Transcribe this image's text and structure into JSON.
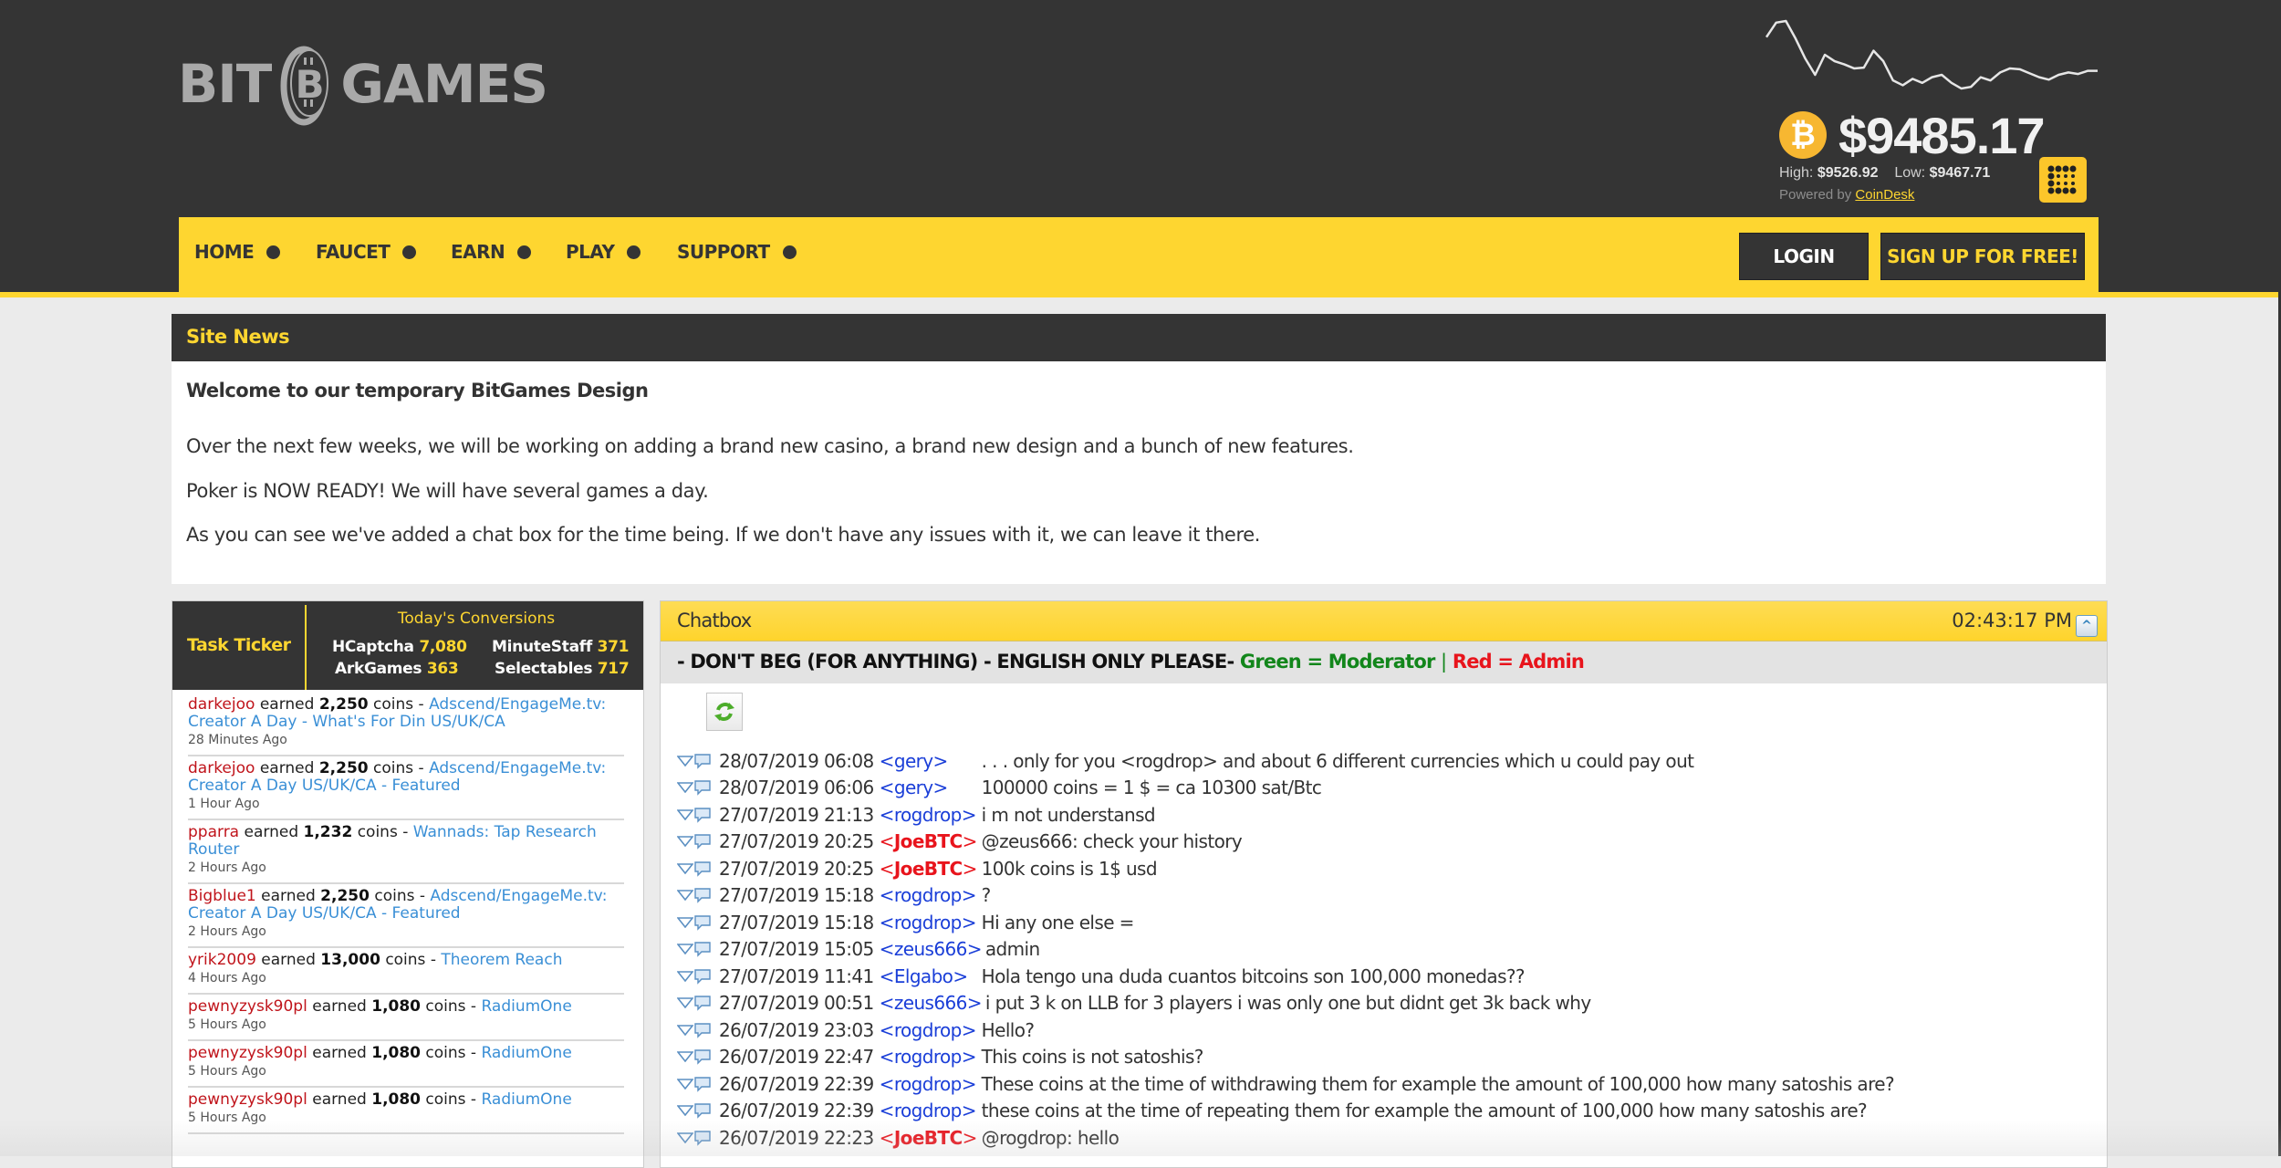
{
  "brand": {
    "logo_left": "BIT",
    "logo_right": "GAMES",
    "logo_coin_icon": "bitcoin-coin-icon"
  },
  "ticker_widget": {
    "price": "$9485.17",
    "high_label": "High:",
    "high_value": "$9526.92",
    "low_label": "Low:",
    "low_value": "$9467.71",
    "powered_by": "Powered by",
    "powered_link": "CoinDesk",
    "coin_glyph": "₿",
    "sparkline_trend": [
      0.72,
      0.9,
      0.92,
      0.7,
      0.45,
      0.25,
      0.5,
      0.42,
      0.38,
      0.33,
      0.34,
      0.55,
      0.42,
      0.18,
      0.12,
      0.2,
      0.15,
      0.22,
      0.25,
      0.15,
      0.08,
      0.1,
      0.22,
      0.18,
      0.28,
      0.33,
      0.32,
      0.27,
      0.22,
      0.19,
      0.25,
      0.28,
      0.26,
      0.3,
      0.3
    ]
  },
  "nav": {
    "items": [
      "HOME",
      "FAUCET",
      "EARN",
      "PLAY",
      "SUPPORT"
    ],
    "login": "LOGIN",
    "signup": "SIGN UP FOR FREE!"
  },
  "site_news": {
    "title": "Site News",
    "heading": "Welcome to our temporary BitGames Design",
    "paragraphs": [
      "Over the next few weeks, we will be working on adding a brand new casino, a brand new design and a bunch of new features.",
      "Poker is NOW READY! We will have several games a day.",
      "As you can see we've added a chat box for the time being. If we don't have any issues with it, we can leave it there."
    ]
  },
  "task_ticker": {
    "title": "Task Ticker",
    "conversions_title": "Today's Conversions",
    "conversions": [
      {
        "name": "HCaptcha",
        "count": "7,080"
      },
      {
        "name": "MinuteStaff",
        "count": "371"
      },
      {
        "name": "ArkGames",
        "count": "363"
      },
      {
        "name": "Selectables",
        "count": "717"
      }
    ],
    "earned_word": "earned",
    "coins_word": "coins -",
    "items": [
      {
        "user": "darkejoo",
        "coins": "2,250",
        "task": "Adscend/EngageMe.tv: Creator A Day - What's For Din US/UK/CA",
        "time": "28 Minutes Ago"
      },
      {
        "user": "darkejoo",
        "coins": "2,250",
        "task": "Adscend/EngageMe.tv: Creator A Day US/UK/CA - Featured",
        "time": "1 Hour Ago"
      },
      {
        "user": "pparra",
        "coins": "1,232",
        "task": "Wannads: Tap Research Router",
        "time": "2 Hours Ago"
      },
      {
        "user": "Bigblue1",
        "coins": "2,250",
        "task": "Adscend/EngageMe.tv: Creator A Day US/UK/CA - Featured",
        "time": "2 Hours Ago"
      },
      {
        "user": "yrik2009",
        "coins": "13,000",
        "task": "Theorem Reach",
        "time": "4 Hours Ago"
      },
      {
        "user": "pewnyzysk90pl",
        "coins": "1,080",
        "task": "RadiumOne",
        "time": "5 Hours Ago"
      },
      {
        "user": "pewnyzysk90pl",
        "coins": "1,080",
        "task": "RadiumOne",
        "time": "5 Hours Ago"
      },
      {
        "user": "pewnyzysk90pl",
        "coins": "1,080",
        "task": "RadiumOne",
        "time": "5 Hours Ago"
      }
    ]
  },
  "chatbox": {
    "title": "Chatbox",
    "clock": "02:43:17 PM",
    "rules": "- DON'T BEG (FOR ANYTHING) - ENGLISH ONLY PLEASE-",
    "legend_green": "Green = Moderator",
    "legend_sep": "|",
    "legend_red": "Red = Admin",
    "colors": {
      "moderator": "#12861b",
      "admin": "#e8141c",
      "user": "#1a3ed8"
    },
    "messages": [
      {
        "date": "28/07/2019 06:08",
        "nick": "gery",
        "role": "user",
        "text": ". . . only for you <rogdrop> and about 6 different currencies which u could pay out"
      },
      {
        "date": "28/07/2019 06:06",
        "nick": "gery",
        "role": "user",
        "text": "100000 coins = 1 $ = ca 10300 sat/Btc"
      },
      {
        "date": "27/07/2019 21:13",
        "nick": "rogdrop",
        "role": "user",
        "text": "i m not understansd"
      },
      {
        "date": "27/07/2019 20:25",
        "nick": "JoeBTC",
        "role": "admin",
        "text": "@zeus666: check your history"
      },
      {
        "date": "27/07/2019 20:25",
        "nick": "JoeBTC",
        "role": "admin",
        "text": "100k coins is 1$ usd"
      },
      {
        "date": "27/07/2019 15:18",
        "nick": "rogdrop",
        "role": "user",
        "text": "?"
      },
      {
        "date": "27/07/2019 15:18",
        "nick": "rogdrop",
        "role": "user",
        "text": "Hi any one else ="
      },
      {
        "date": "27/07/2019 15:05",
        "nick": "zeus666",
        "role": "user",
        "text": "admin"
      },
      {
        "date": "27/07/2019 11:41",
        "nick": "Elgabo",
        "role": "user",
        "text": "Hola tengo una duda cuantos bitcoins son 100,000 monedas??"
      },
      {
        "date": "27/07/2019 00:51",
        "nick": "zeus666",
        "role": "user",
        "text": "i put 3 k on LLB for 3 players i was only one but didnt get 3k back why"
      },
      {
        "date": "26/07/2019 23:03",
        "nick": "rogdrop",
        "role": "user",
        "text": "Hello?"
      },
      {
        "date": "26/07/2019 22:47",
        "nick": "rogdrop",
        "role": "user",
        "text": "This coins is not satoshis?"
      },
      {
        "date": "26/07/2019 22:39",
        "nick": "rogdrop",
        "role": "user",
        "text": "These coins at the time of withdrawing them for example the amount of 100,000 how many satoshis are?"
      },
      {
        "date": "26/07/2019 22:39",
        "nick": "rogdrop",
        "role": "user",
        "text": "these coins at the time of repeating them for example the amount of 100,000 how many satoshis are?"
      },
      {
        "date": "26/07/2019 22:23",
        "nick": "JoeBTC",
        "role": "admin",
        "text": "@rogdrop: hello"
      }
    ]
  },
  "theme": {
    "yellow": "#fed630",
    "dark": "#343434",
    "link_blue": "#3a8fd6",
    "user_red": "#c0141b"
  }
}
